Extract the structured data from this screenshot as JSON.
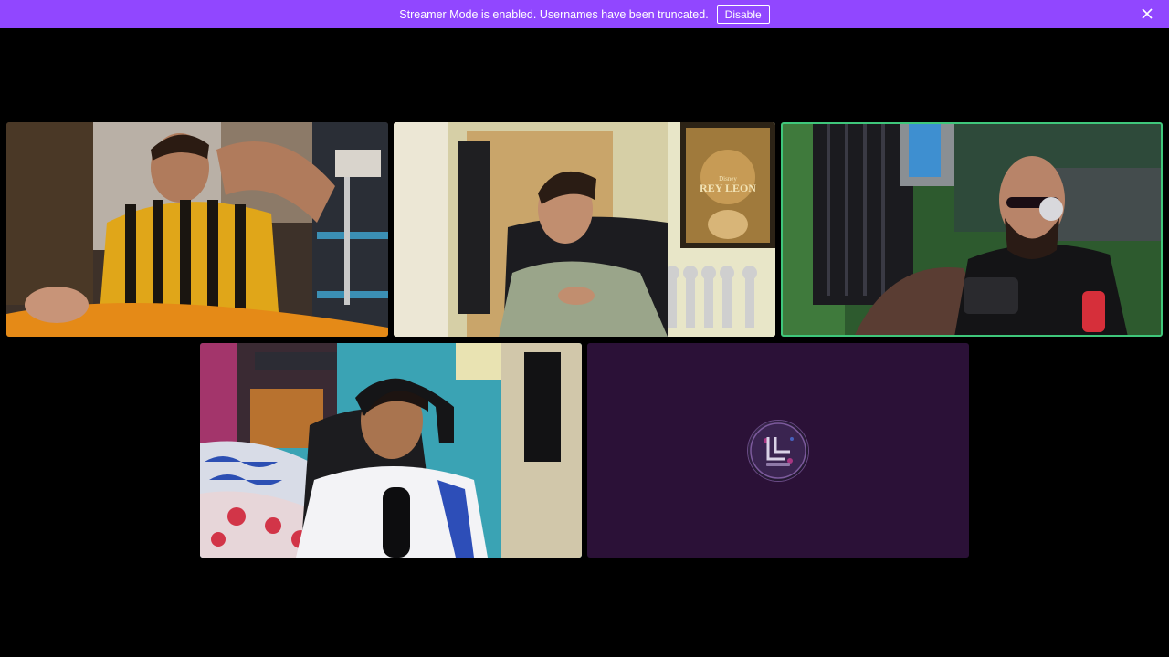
{
  "banner": {
    "message": "Streamer Mode is enabled. Usernames have been truncated.",
    "disable_label": "Disable",
    "close_icon": "close-icon",
    "color": "#9147ff"
  },
  "tiles": [
    {
      "kind": "video",
      "speaking": false
    },
    {
      "kind": "video",
      "speaking": false
    },
    {
      "kind": "video",
      "speaking": true
    },
    {
      "kind": "video",
      "speaking": false
    },
    {
      "kind": "avatar",
      "speaking": false
    }
  ],
  "poster": {
    "title": "REY LEON",
    "brand": "Disney"
  },
  "colors": {
    "background": "#000000",
    "speaking_ring": "#3fc77b",
    "avatar_tile": "#2b1137"
  }
}
